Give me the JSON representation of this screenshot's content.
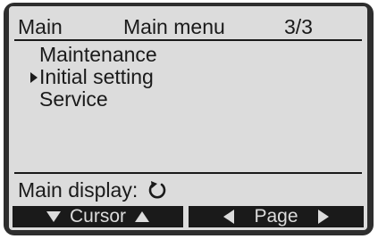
{
  "header": {
    "left_label": "Main",
    "title": "Main menu",
    "page": "3/3"
  },
  "menu": {
    "items": [
      {
        "label": "Maintenance",
        "selected": false
      },
      {
        "label": "Initial setting",
        "selected": true
      },
      {
        "label": "Service",
        "selected": false
      }
    ]
  },
  "footer": {
    "main_display_label": "Main display:",
    "return_icon": "return-arrow-icon"
  },
  "softkeys": {
    "cursor_label": "Cursor",
    "page_label": "Page"
  },
  "colors": {
    "screen_bg": "#dcdcdc",
    "ink": "#1a1a1a",
    "bezel": "#2e2e2e"
  }
}
